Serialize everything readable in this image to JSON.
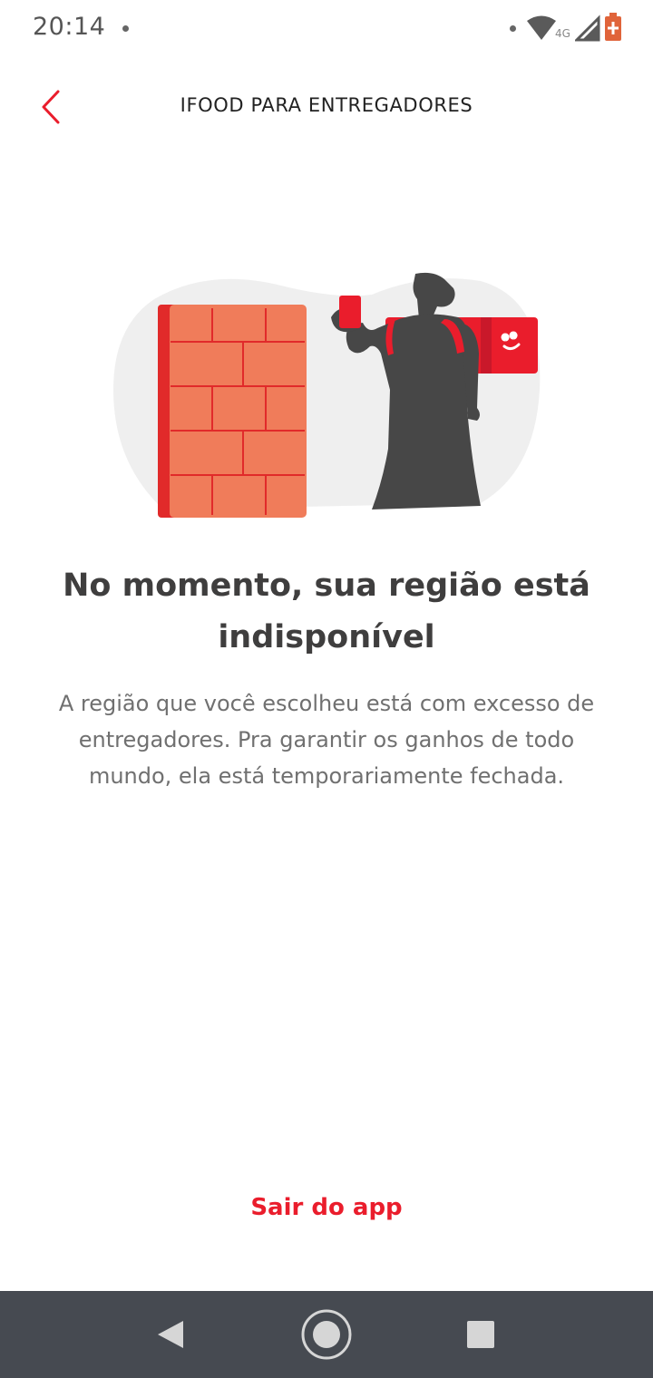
{
  "status_bar": {
    "time": "20:14",
    "network_label": "4G",
    "icons": [
      "notification-dot-icon",
      "wifi-icon",
      "signal-icon",
      "battery-icon"
    ]
  },
  "app_bar": {
    "title": "IFOOD PARA ENTREGADORES",
    "back_icon": "chevron-left-icon"
  },
  "illustration": {
    "brand_icon": "ifood-smile-icon"
  },
  "content": {
    "headline": "No momento, sua região está indisponível",
    "description": "A região que você escolheu está com excesso de entregadores. Pra garantir os ganhos de todo mundo, ela está temporariamente fechada."
  },
  "actions": {
    "exit_label": "Sair do app"
  },
  "nav_bar": {
    "items": [
      "back-triangle-icon",
      "home-circle-icon",
      "recents-square-icon"
    ]
  },
  "colors": {
    "brand_red": "#ea1d2c",
    "brick": "#f07c5a",
    "figure": "#474747",
    "blob": "#efefef",
    "nav_background": "#464a51"
  }
}
